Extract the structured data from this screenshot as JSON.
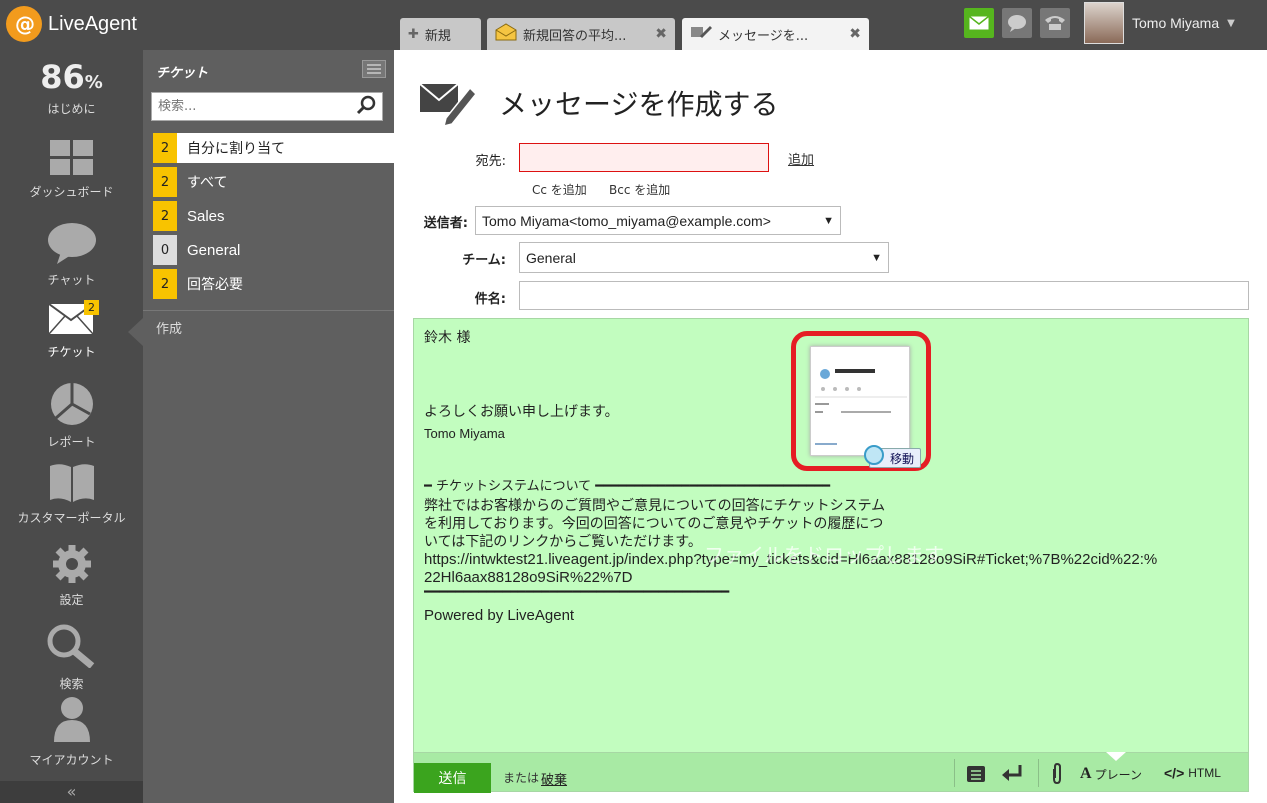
{
  "app": {
    "name": "LiveAgent"
  },
  "tabs": [
    {
      "label": "新規",
      "icon": "plus-icon"
    },
    {
      "label": "新規回答の平均...",
      "icon": "envelope-open-icon"
    },
    {
      "label": "メッセージを...",
      "icon": "compose-icon"
    }
  ],
  "user": {
    "name": "Tomo Miyama"
  },
  "nav": {
    "progress": {
      "value": "86",
      "unit": "%",
      "label": "はじめに"
    },
    "items": [
      {
        "label": "ダッシュボード",
        "icon": "dashboard-icon"
      },
      {
        "label": "チャット",
        "icon": "chat-icon"
      },
      {
        "label": "チケット",
        "icon": "ticket-icon",
        "badge": "2"
      },
      {
        "label": "レポート",
        "icon": "report-icon"
      },
      {
        "label": "カスタマーポータル",
        "icon": "book-icon"
      },
      {
        "label": "設定",
        "icon": "gear-icon"
      },
      {
        "label": "検索",
        "icon": "search-icon"
      },
      {
        "label": "マイアカウント",
        "icon": "user-icon"
      }
    ],
    "collapse": "«"
  },
  "ticket_panel": {
    "title": "チケット",
    "search_placeholder": "検索...",
    "filters": [
      {
        "count": "2",
        "label": "自分に割り当て"
      },
      {
        "count": "2",
        "label": "すべて"
      },
      {
        "count": "2",
        "label": "Sales"
      },
      {
        "count": "0",
        "label": "General"
      },
      {
        "count": "2",
        "label": "回答必要"
      }
    ],
    "create": "作成"
  },
  "compose": {
    "title": "メッセージを作成する",
    "to_label": "宛先:",
    "add_link": "追加",
    "cc_link": "Cc を追加",
    "bcc_link": "Bcc を追加",
    "from_label": "送信者:",
    "from_value": "Tomo Miyama<tomo_miyama@example.com>",
    "team_label": "チーム:",
    "team_value": "General",
    "subject_label": "件名:",
    "body": {
      "greeting": "鈴木 様",
      "closing": "よろしくお願い申し上げます。",
      "signature": "Tomo Miyama",
      "section_title": "━ チケットシステムについて ━━━━━━━━━━━━━━━━━━━━━━━━━━━━━━",
      "para1": "弊社ではお客様からのご質問やご意見についての回答にチケットシステム",
      "para2": "を利用しております。今回の回答についてのご意見やチケットの履歴につ",
      "para3": "いては下記のリンクからご覧いただけます。",
      "url1": "https://intwktest21.liveagent.jp/index.php?type=my_tickets&cid=Hl6aax88128o9SiR#Ticket;%7B%22cid%22:%",
      "url2": "22Hl6aax88128o9SiR%22%7D",
      "rule": "━━━━━━━━━━━━━━━━━━━━━━━━━━━━━━━━━━━━━━━",
      "powered": "Powered by LiveAgent"
    },
    "drop_hint": "ファイルをドロップします",
    "thumb_move": "移動",
    "send": "送信",
    "or": "または",
    "discard": "破棄",
    "plain": "プレーン",
    "html": "HTML"
  },
  "colors": {
    "accent_orange": "#f29b1d",
    "send_green": "#3ba41e",
    "editor_bg": "#c2fdbf",
    "badge_yellow": "#f8c300",
    "highlight_red": "#e51d24"
  }
}
